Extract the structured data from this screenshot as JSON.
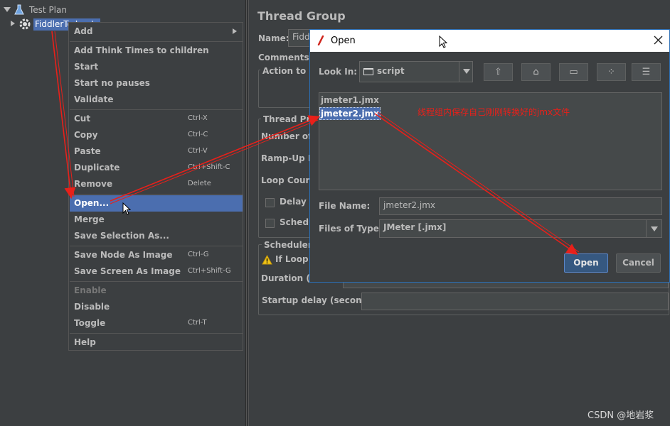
{
  "tree": {
    "root_label": "Test Plan",
    "child_label": "FiddlerTo Jmeter"
  },
  "context_menu": {
    "items": [
      {
        "label": "Add",
        "shortcut": "",
        "has_submenu": true
      },
      {
        "label": "Add Think Times to children",
        "shortcut": ""
      },
      {
        "label": "Start",
        "shortcut": ""
      },
      {
        "label": "Start no pauses",
        "shortcut": ""
      },
      {
        "label": "Validate",
        "shortcut": ""
      },
      {
        "label": "Cut",
        "shortcut": "Ctrl-X"
      },
      {
        "label": "Copy",
        "shortcut": "Ctrl-C"
      },
      {
        "label": "Paste",
        "shortcut": "Ctrl-V"
      },
      {
        "label": "Duplicate",
        "shortcut": "Ctrl+Shift-C"
      },
      {
        "label": "Remove",
        "shortcut": "Delete"
      },
      {
        "label": "Open...",
        "shortcut": "",
        "selected": true
      },
      {
        "label": "Merge",
        "shortcut": ""
      },
      {
        "label": "Save Selection As...",
        "shortcut": ""
      },
      {
        "label": "Save Node As Image",
        "shortcut": "Ctrl-G"
      },
      {
        "label": "Save Screen As Image",
        "shortcut": "Ctrl+Shift-G"
      },
      {
        "label": "Enable",
        "shortcut": "",
        "disabled": true
      },
      {
        "label": "Disable",
        "shortcut": ""
      },
      {
        "label": "Toggle",
        "shortcut": "Ctrl-T"
      },
      {
        "label": "Help",
        "shortcut": ""
      }
    ]
  },
  "thread_group": {
    "title": "Thread Group",
    "name_label": "Name:",
    "name_value": "Fidd",
    "comments_label": "Comments:",
    "action_label": "Action to be",
    "thread_props_label": "Thread Prop",
    "num_threads_label": "Number of T",
    "ramp_up_label": "Ramp-Up Pe",
    "loop_count_label": "Loop Count:",
    "delay_label": "Delay T",
    "scheduler_cb_label": "Schedu",
    "scheduler_group_label": "Scheduler C",
    "if_loop_label": "If Loop C",
    "duration_label": "Duration (se",
    "startup_delay_label": "Startup delay (seconds)"
  },
  "open_dialog": {
    "title": "Open",
    "look_in_label": "Look In:",
    "look_in_value": "script",
    "files": [
      "jmeter1.jmx",
      "jmeter2.jmx"
    ],
    "selected_file": "jmeter2.jmx",
    "annotation": "线程组内保存自己刚刚转换好的jmx文件",
    "file_name_label": "File Name:",
    "file_name_value": "jmeter2.jmx",
    "files_of_type_label": "Files of Type:",
    "files_of_type_value": "JMeter [.jmx]",
    "open_button": "Open",
    "cancel_button": "Cancel"
  },
  "watermark": "CSDN @地岩浆",
  "colors": {
    "background": "#3c3f41",
    "selection": "#4b6eaf",
    "annotation_red": "#e8201a",
    "dialog_border": "#2b6fb6"
  },
  "icons": [
    "expand-triangle-icon",
    "test-plan-flask-icon",
    "thread-group-gear-icon",
    "submenu-arrow-icon",
    "close-icon",
    "folder-icon",
    "folder-up-icon",
    "home-icon",
    "new-folder-icon",
    "list-view-icon",
    "details-view-icon",
    "warning-icon",
    "dropdown-arrow-icon",
    "mouse-cursor-icon"
  ]
}
